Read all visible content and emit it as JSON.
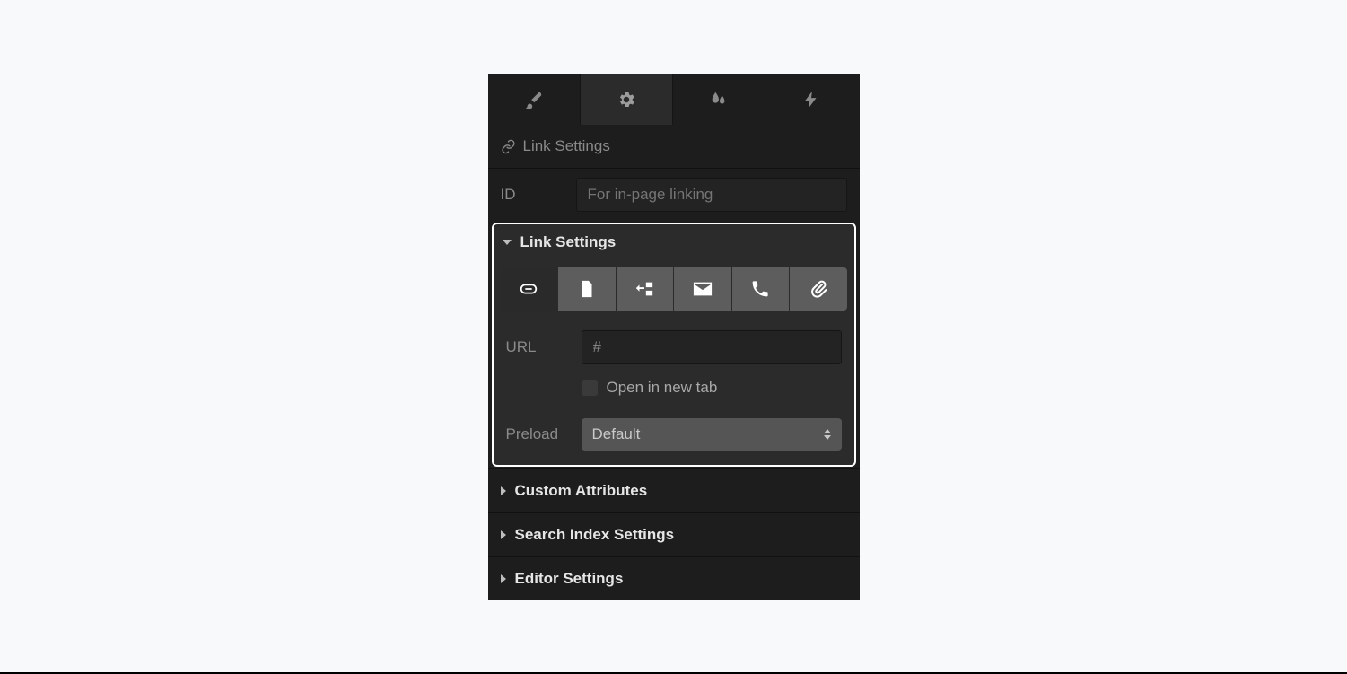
{
  "tabs": [
    {
      "icon": "brush"
    },
    {
      "icon": "gear",
      "active": true
    },
    {
      "icon": "droplet"
    },
    {
      "icon": "bolt"
    }
  ],
  "header": {
    "title": "Link Settings"
  },
  "idRow": {
    "label": "ID",
    "placeholder": "For in-page linking",
    "value": ""
  },
  "linkSettings": {
    "title": "Link Settings",
    "typeButtons": [
      {
        "name": "url",
        "icon": "link",
        "selected": true
      },
      {
        "name": "page",
        "icon": "page"
      },
      {
        "name": "section",
        "icon": "section"
      },
      {
        "name": "email",
        "icon": "mail"
      },
      {
        "name": "phone",
        "icon": "phone"
      },
      {
        "name": "file",
        "icon": "paperclip"
      }
    ],
    "urlLabel": "URL",
    "urlValue": "#",
    "openNewTabLabel": "Open in new tab",
    "openNewTabChecked": false,
    "preloadLabel": "Preload",
    "preloadValue": "Default"
  },
  "sections": [
    {
      "title": "Custom Attributes"
    },
    {
      "title": "Search Index Settings"
    },
    {
      "title": "Editor Settings"
    }
  ]
}
